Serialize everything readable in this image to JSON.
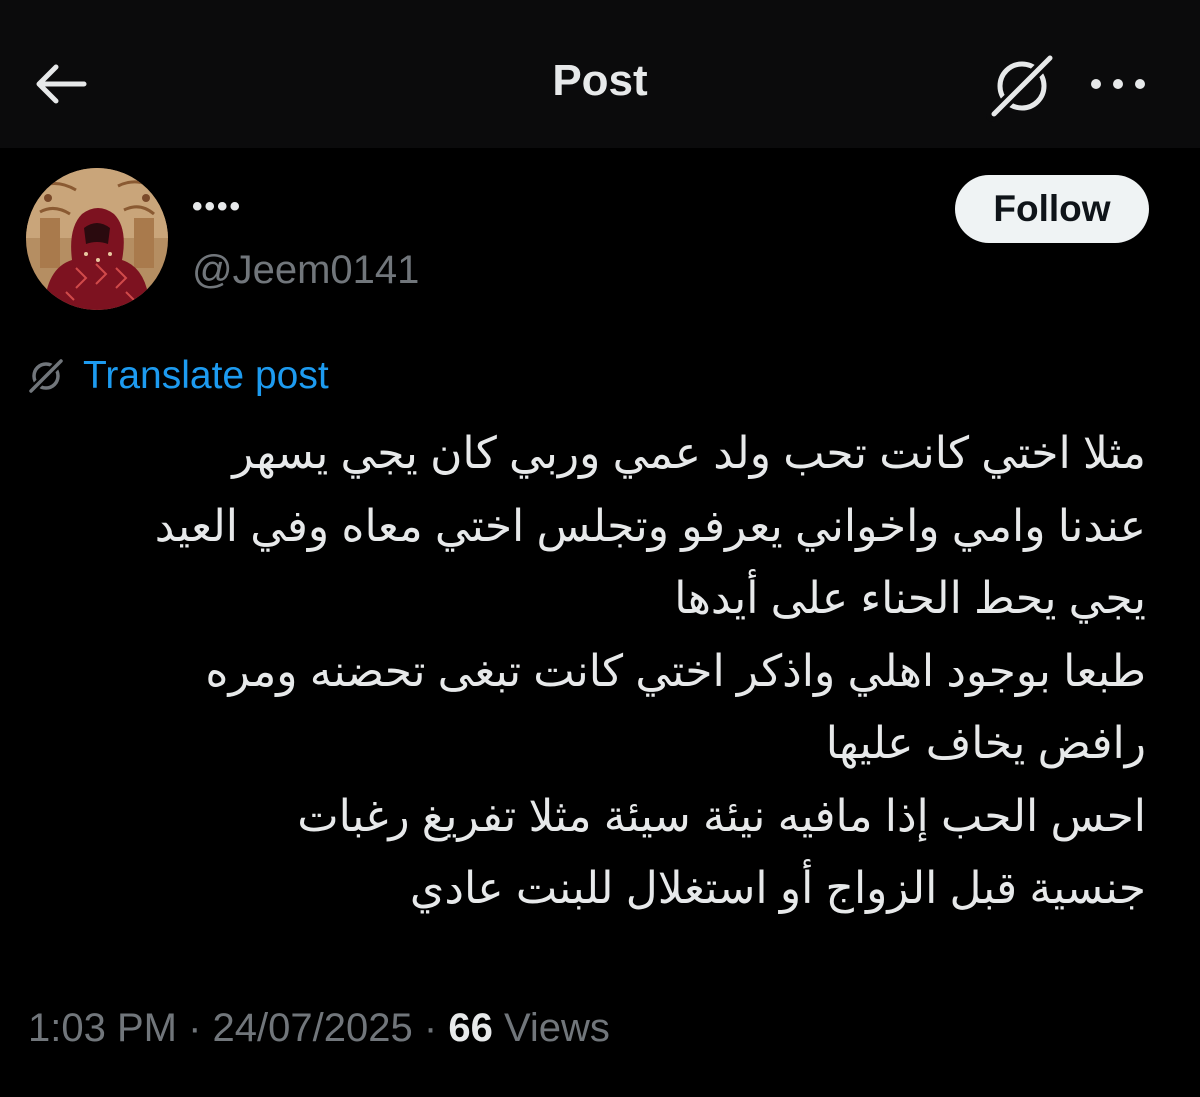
{
  "header": {
    "title": "Post",
    "back_icon": "arrow-left-icon",
    "translate_icon": "translate-icon",
    "more_icon": "more-horizontal-icon"
  },
  "author": {
    "display_name": "••••",
    "handle": "@Jeem0141",
    "avatar_icon": "avatar-image"
  },
  "follow_button": {
    "label": "Follow"
  },
  "translate": {
    "label": "Translate post",
    "icon": "translate-icon"
  },
  "post": {
    "lines": [
      "مثلا اختي كانت تحب ولد عمي وربي كان يجي يسهر",
      "عندنا وامي واخواني يعرفو وتجلس اختي معاه وفي العيد",
      "يجي يحط الحناء على أيدها",
      "طبعا بوجود اهلي واذكر اختي كانت تبغى تحضنه ومره",
      "رافض يخاف عليها",
      "احس الحب إذا مافيه نيئة سيئة مثلا تفريغ رغبات",
      "جنسية قبل الزواج أو استغلال للبنت عادي"
    ]
  },
  "meta": {
    "time": "1:03 PM",
    "separator": "·",
    "date": "24/07/2025",
    "views_count": "66",
    "views_label": "Views"
  },
  "colors": {
    "background": "#000000",
    "header_background": "#0b0b0c",
    "text_primary": "#e7e9ea",
    "text_secondary": "#71767b",
    "link": "#1d9bf0",
    "follow_bg": "#eff3f4"
  }
}
